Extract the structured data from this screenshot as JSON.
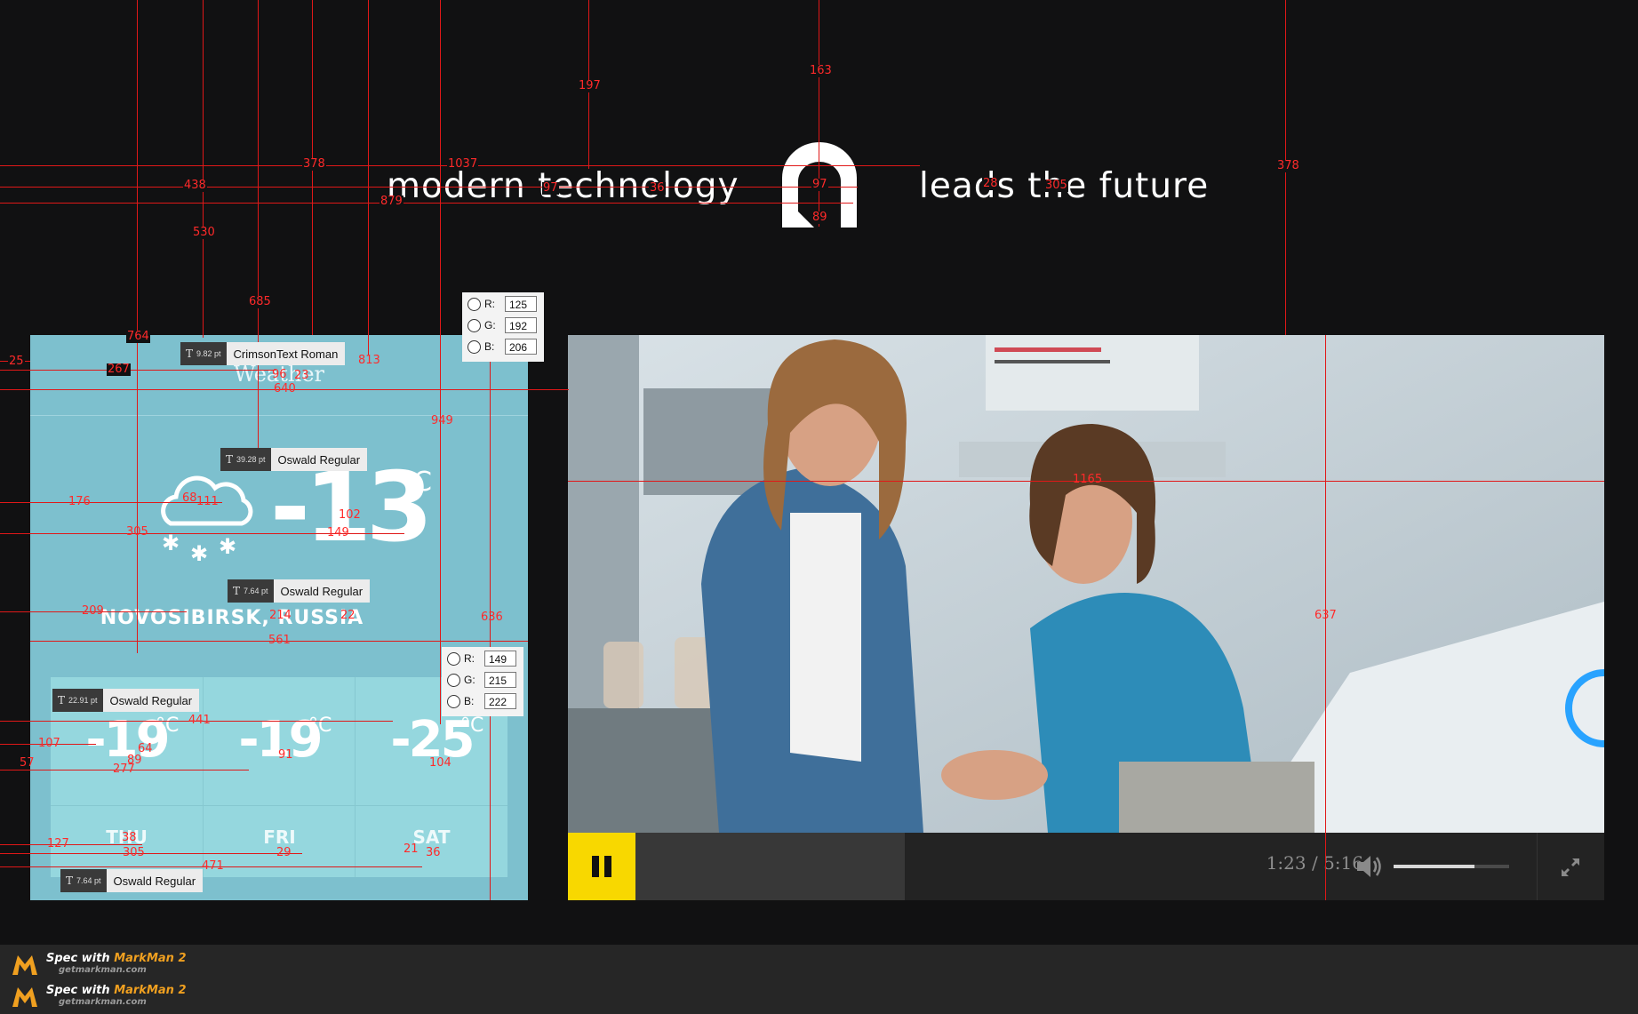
{
  "header": {
    "tagline_left": "modern technology",
    "tagline_right": "leads the future"
  },
  "weather": {
    "title": "Weather",
    "current_temp": "-13",
    "unit": "°C",
    "location": "NOVOSIBIRSK, RUSSIA",
    "forecast": [
      {
        "temp": "-19",
        "unit": "°C",
        "day": "THU"
      },
      {
        "temp": "-19",
        "unit": "°C",
        "day": "FRI"
      },
      {
        "temp": "-25",
        "unit": "°C",
        "day": "SAT"
      }
    ],
    "bg_color": "#7dc0ce",
    "forecast_bg_color": "#95d7de"
  },
  "font_tags": {
    "title": {
      "size": "9.82 pt",
      "font": "CrimsonText Roman"
    },
    "current_temp": {
      "size": "39.28 pt",
      "font": "Oswald Regular"
    },
    "location": {
      "size": "7.64 pt",
      "font": "Oswald Regular"
    },
    "forecast_temp": {
      "size": "22.91 pt",
      "font": "Oswald Regular"
    },
    "forecast_day": {
      "size": "7.64 pt",
      "font": "Oswald Regular"
    }
  },
  "color_pickers": [
    {
      "r": "125",
      "g": "192",
      "b": "206"
    },
    {
      "r": "149",
      "g": "215",
      "b": "222"
    }
  ],
  "rgb_labels": {
    "r": "R:",
    "g": "G:",
    "b": "B:"
  },
  "video": {
    "current_time": "1:23",
    "separator": "/",
    "duration": "5:16",
    "progress_fraction": 0.26,
    "volume_fraction": 0.7,
    "play_button_color": "#f8d800",
    "play_state_icon": "pause-icon"
  },
  "measurements": {
    "top": [
      "197",
      "163",
      "1037",
      "378",
      "378",
      "438",
      "879",
      "530",
      "685",
      "36",
      "97",
      "89",
      "28",
      "305",
      "378"
    ],
    "weather": [
      "764",
      "25",
      "267",
      "96",
      "23",
      "640",
      "813",
      "949",
      "176",
      "68",
      "111",
      "102",
      "305",
      "149",
      "209",
      "214",
      "22",
      "561",
      "636",
      "441",
      "107",
      "64",
      "89",
      "91",
      "57",
      "277",
      "104",
      "127",
      "38",
      "305",
      "29",
      "21",
      "36",
      "471"
    ],
    "video": [
      "1165",
      "637"
    ]
  },
  "footer": {
    "badges": [
      {
        "prefix": "Spec with ",
        "brand": "MarkMan 2",
        "url": "getmarkman.com"
      },
      {
        "prefix": "Spec with ",
        "brand": "MarkMan 2",
        "url": "getmarkman.com"
      }
    ]
  }
}
